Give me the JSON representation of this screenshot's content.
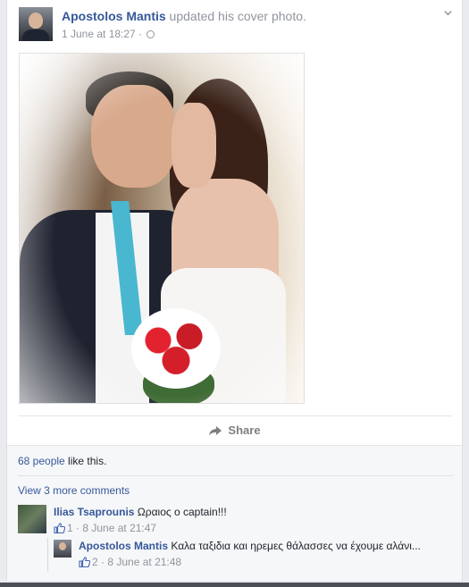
{
  "post": {
    "author": "Apostolos Mantis",
    "action": " updated his cover photo.",
    "timestamp": "1 June at 18:27",
    "separator": " · ",
    "privacy_icon": "globe-icon",
    "options_icon": "chevron-down-icon"
  },
  "actions": {
    "share_label": "Share",
    "share_icon": "share-arrow-icon"
  },
  "likes": {
    "count_text": "68 people",
    "suffix": " like this."
  },
  "comments": {
    "view_more": "View 3 more comments",
    "items": [
      {
        "author": "Ilias Tsaprounis",
        "text": " Ωραιος ο captain!!!",
        "like_count": "1",
        "separator": " · ",
        "time": "8 June at 21:47"
      },
      {
        "author": "Apostolos Mantis",
        "text": " Καλα ταξιδια και ηρεμες θάλασσες να έχουμε αλάνι...",
        "like_count": "2",
        "separator": " · ",
        "time": "8 June at 21:48"
      }
    ]
  },
  "colors": {
    "link": "#365899",
    "meta": "#90949c",
    "footer_bg": "#f6f7f9"
  }
}
